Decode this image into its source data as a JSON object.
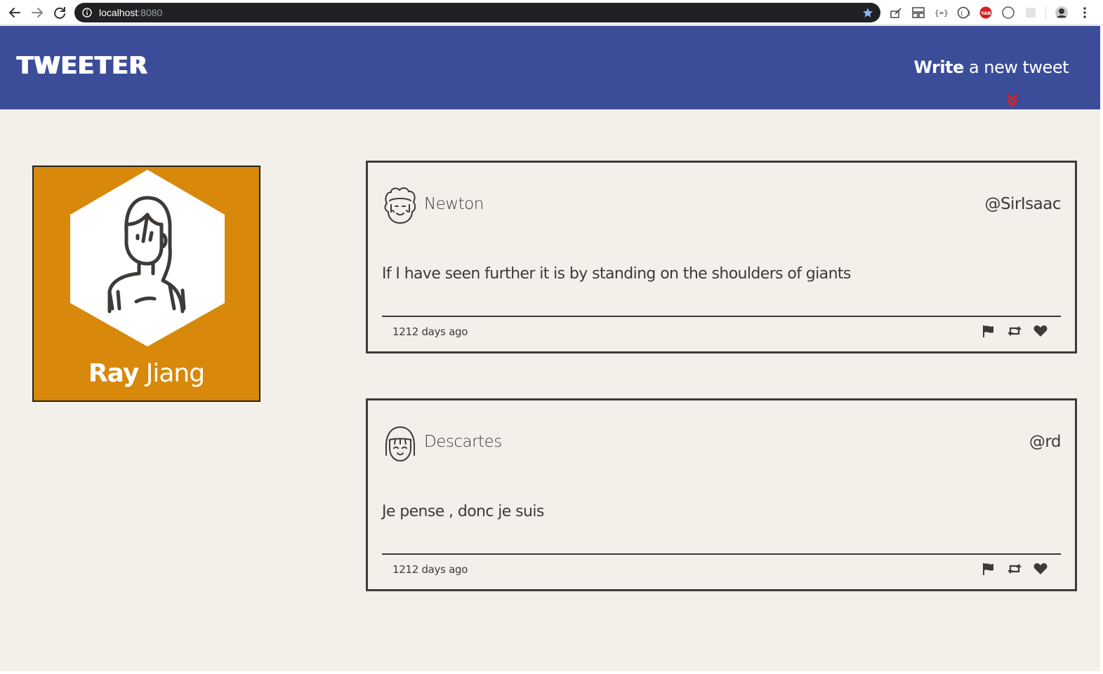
{
  "browser": {
    "url_host": "localhost",
    "url_port": ":8080"
  },
  "nav": {
    "logo": "TWEETER",
    "compose_bold": "Write",
    "compose_rest": " a new tweet",
    "toggle_icon": "double-chevron-down-icon",
    "toggle_color": "#e01e1e"
  },
  "profile": {
    "first_name": "Ray",
    "last_name": " Jiang",
    "card_color": "#d8880a"
  },
  "tweets": [
    {
      "author": "Newton",
      "handle": "@SirIsaac",
      "content": "If I have seen further it is by standing on the shoulders of giants",
      "age": "1212 days ago",
      "avatar_icon": "curly-hair-avatar-icon"
    },
    {
      "author": "Descartes",
      "handle": "@rd",
      "content": "Je pense , donc je suis",
      "age": "1212 days ago",
      "avatar_icon": "bangs-hair-avatar-icon"
    }
  ],
  "colors": {
    "nav_bg": "#3b4d99",
    "page_bg": "#f3f0ea",
    "text": "#3e3a37"
  }
}
